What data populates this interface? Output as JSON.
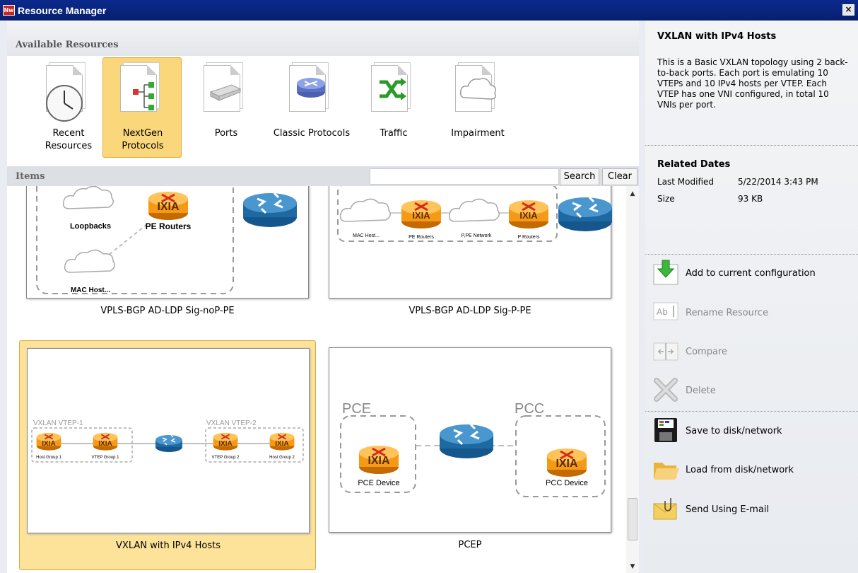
{
  "window": {
    "title": "Resource Manager",
    "app_badge": "Nw",
    "close_glyph": "×"
  },
  "available": {
    "header": "Available Resources",
    "resources": [
      {
        "label": "Recent Resources",
        "icon": "clock-icon",
        "selected": false
      },
      {
        "label": "NextGen Protocols",
        "icon": "protocol-tree-icon",
        "selected": true
      },
      {
        "label": "Ports",
        "icon": "chassis-icon",
        "selected": false
      },
      {
        "label": "Classic Protocols",
        "icon": "router-icon",
        "selected": false
      },
      {
        "label": "Traffic",
        "icon": "traffic-arrows-icon",
        "selected": false
      },
      {
        "label": "Impairment",
        "icon": "cloud-icon",
        "selected": false
      }
    ]
  },
  "items": {
    "header": "Items",
    "search_value": "",
    "search_label": "Search",
    "clear_label": "Clear",
    "cards": [
      {
        "label": "VPLS-BGP AD-LDP Sig-noP-PE",
        "texts": {
          "loopbacks": "Loopbacks",
          "pe": "PE Routers",
          "mac": "MAC Host...",
          "ixia": "IXIA"
        }
      },
      {
        "label": "VPLS-BGP AD-LDP Sig-P-PE",
        "texts": {
          "mac": "MAC Host...",
          "pe": "PE Routers",
          "ppe": "P,PE Network",
          "p": "P Routers",
          "ixia": "IXIA"
        }
      },
      {
        "label": "VXLAN with IPv4 Hosts",
        "selected": true,
        "texts": {
          "vtep1": "VXLAN VTEP-1",
          "vtep2": "VXLAN VTEP-2",
          "hg1": "Host Group 1",
          "vg1": "VTEP Group 1",
          "vg2": "VTEP Group 2",
          "hg2": "Host Group 2",
          "ixia": "IXIA"
        }
      },
      {
        "label": "PCEP",
        "texts": {
          "pce": "PCE",
          "pcc": "PCC",
          "pced": "PCE Device",
          "pccd": "PCC Device",
          "ixia": "IXIA"
        }
      }
    ]
  },
  "details": {
    "title": "VXLAN with IPv4 Hosts",
    "description": "This is a Basic VXLAN topology using 2 back-to-back ports. Each port is emulating 10 VTEPs and 10 IPv4 hosts per VTEP. Each VTEP has one VNI configured, in total 10 VNIs per port.",
    "dates_title": "Related Dates",
    "last_modified_label": "Last Modified",
    "last_modified_value": "5/22/2014 3:43 PM",
    "size_label": "Size",
    "size_value": "93 KB"
  },
  "actions": [
    {
      "label": "Add to current configuration",
      "icon": "add-download-icon",
      "enabled": true
    },
    {
      "label": "Rename Resource",
      "icon": "rename-icon",
      "enabled": false
    },
    {
      "label": "Compare",
      "icon": "compare-icon",
      "enabled": false
    },
    {
      "label": "Delete",
      "icon": "delete-x-icon",
      "enabled": false
    },
    {
      "label": "Save to disk/network",
      "icon": "floppy-disk-icon",
      "enabled": true
    },
    {
      "label": "Load from disk/network",
      "icon": "folder-open-icon",
      "enabled": true
    },
    {
      "label": "Send Using E-mail",
      "icon": "email-icon",
      "enabled": true
    }
  ],
  "colors": {
    "title_bar": "#0a2a8c",
    "selection": "#fbd77b",
    "selection_border": "#e2a83c",
    "ixia_orange": "#f59a16"
  }
}
